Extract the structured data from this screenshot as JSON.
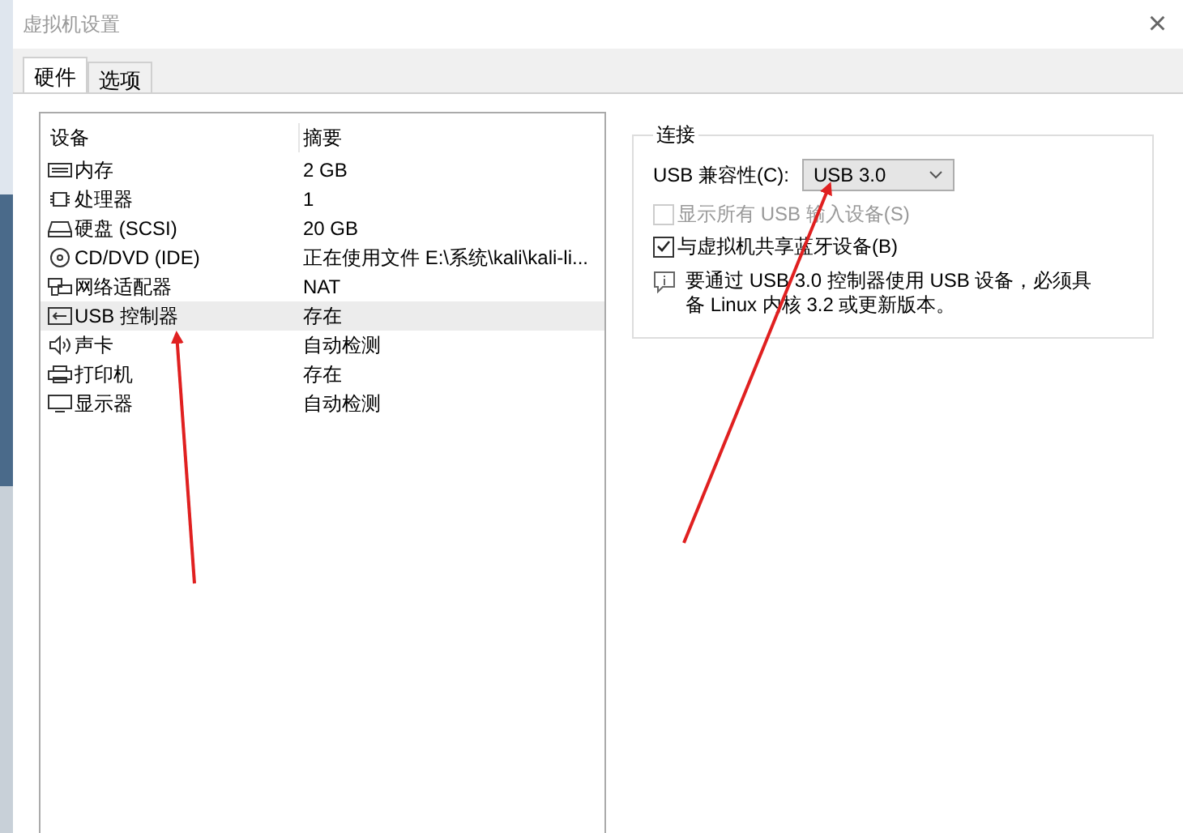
{
  "window": {
    "title": "虚拟机设置",
    "close": "×"
  },
  "tabs": [
    {
      "label": "硬件",
      "selected": true
    },
    {
      "label": "选项",
      "selected": false
    }
  ],
  "devices": {
    "columns": [
      "设备",
      "摘要"
    ],
    "rows": [
      {
        "kind": "memory",
        "name": "内存",
        "summary": "2 GB",
        "selected": false
      },
      {
        "kind": "cpu",
        "name": "处理器",
        "summary": "1",
        "selected": false
      },
      {
        "kind": "disk",
        "name": "硬盘 (SCSI)",
        "summary": "20 GB",
        "selected": false
      },
      {
        "kind": "cdrom",
        "name": "CD/DVD (IDE)",
        "summary": "正在使用文件 E:\\系统\\kali\\kali-li...",
        "selected": false
      },
      {
        "kind": "network",
        "name": "网络适配器",
        "summary": "NAT",
        "selected": false
      },
      {
        "kind": "usb",
        "name": "USB 控制器",
        "summary": "存在",
        "selected": true
      },
      {
        "kind": "sound",
        "name": "声卡",
        "summary": "自动检测",
        "selected": false
      },
      {
        "kind": "printer",
        "name": "打印机",
        "summary": "存在",
        "selected": false
      },
      {
        "kind": "display",
        "name": "显示器",
        "summary": "自动检测",
        "selected": false
      }
    ]
  },
  "connection": {
    "title": "连接",
    "compat_label": "USB 兼容性(C):",
    "compat_value": "USB 3.0",
    "options": [
      {
        "label": "显示所有 USB 输入设备(S)",
        "checked": false,
        "disabled": true
      },
      {
        "label": "与虚拟机共享蓝牙设备(B)",
        "checked": true,
        "disabled": false
      }
    ],
    "note": "要通过 USB 3.0 控制器使用 USB 设备，必须具备 Linux 内核 3.2 或更新版本。"
  }
}
